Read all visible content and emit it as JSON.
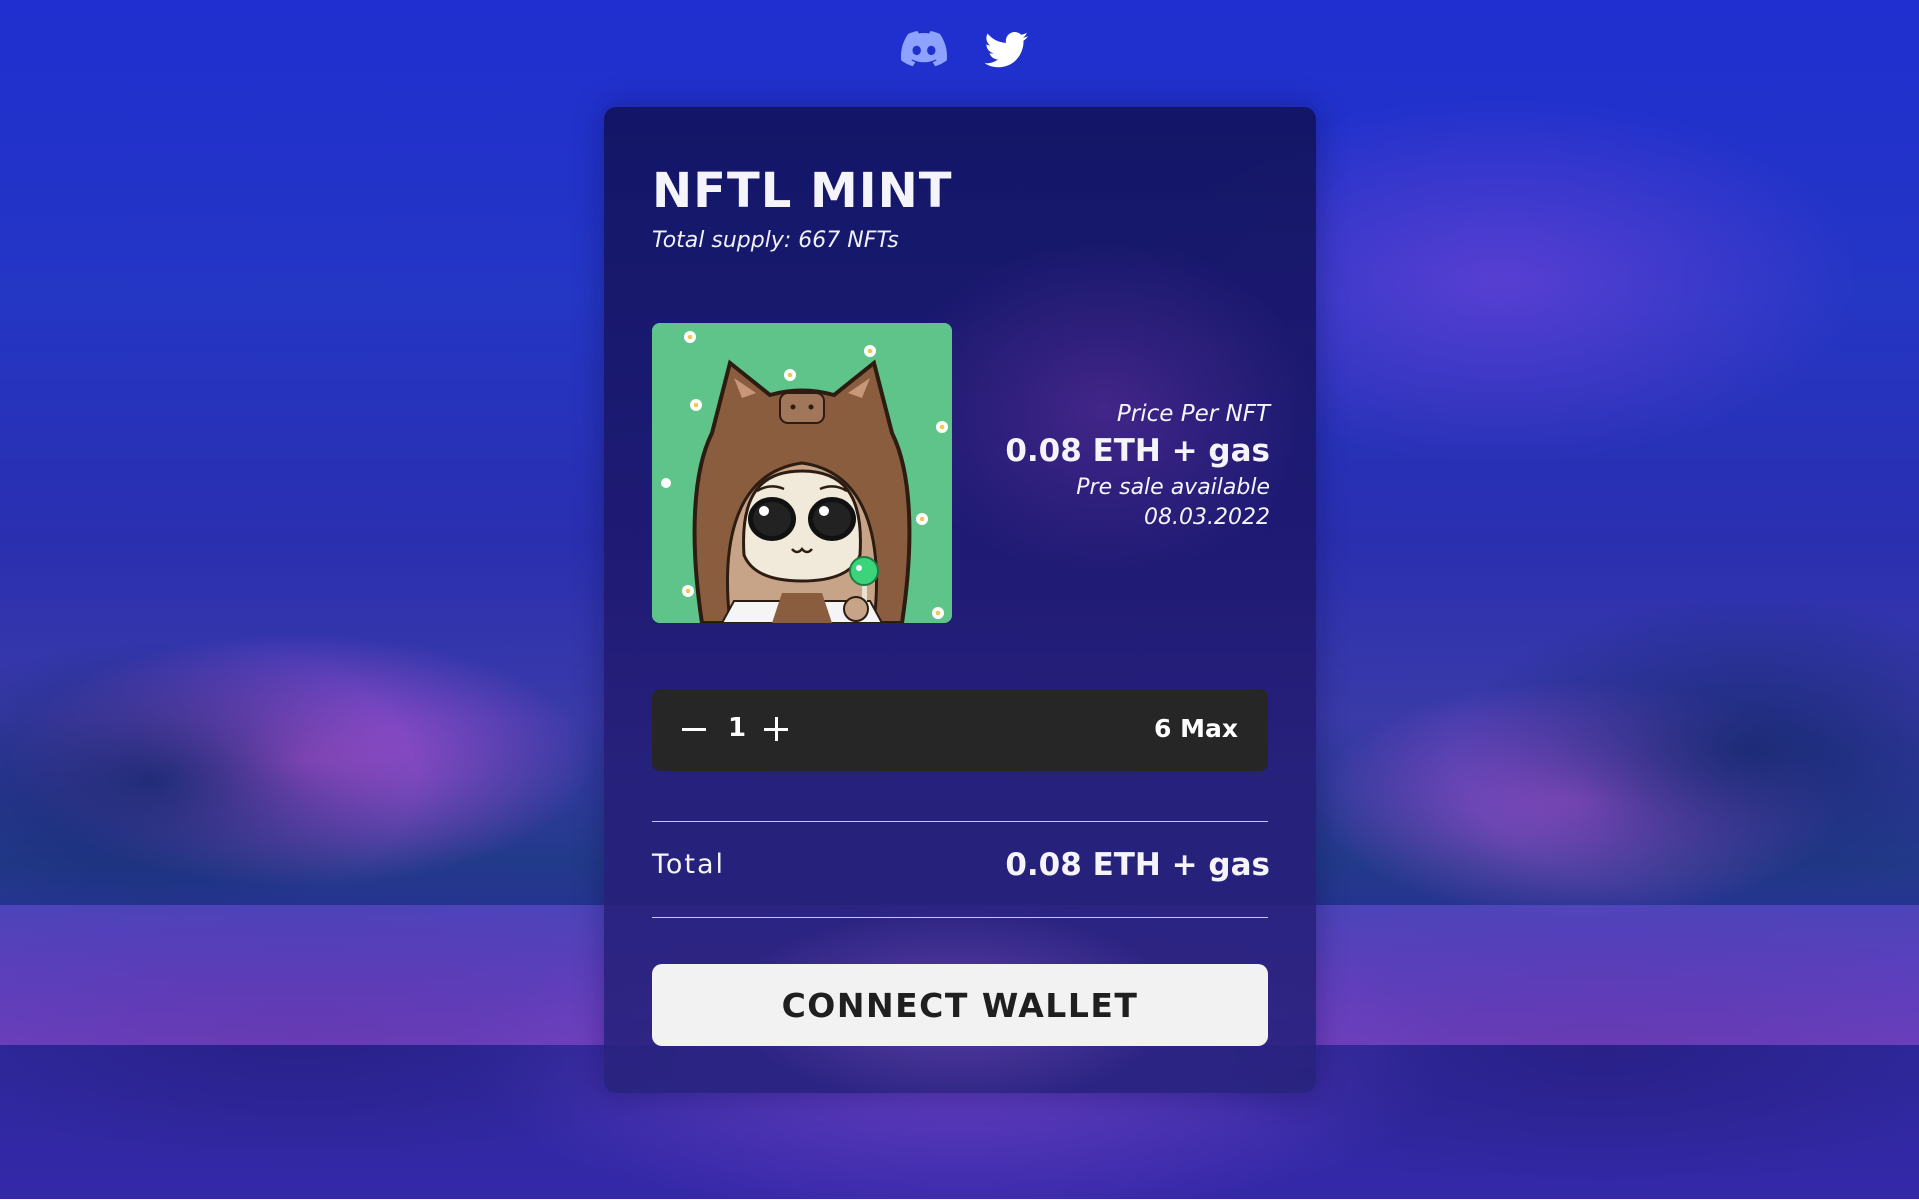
{
  "social": {
    "discord_icon": "discord-icon",
    "twitter_icon": "twitter-icon"
  },
  "mint": {
    "title": "NFTL MINT",
    "supply": "Total supply: 667 NFTs",
    "price_label": "Price Per NFT",
    "price_value": "0.08 ETH + gas",
    "presale_line1": "Pre sale available",
    "presale_line2": "08.03.2022"
  },
  "quantity": {
    "value": "1",
    "max_label": "6 Max"
  },
  "total": {
    "label": "Total",
    "value": "0.08 ETH + gas"
  },
  "actions": {
    "connect_label": "CONNECT WALLET"
  },
  "colors": {
    "card_bg": "#14165f",
    "quantity_bar": "#262626",
    "button_bg": "#f2f2f2",
    "nft_bg": "#5fc48a"
  }
}
